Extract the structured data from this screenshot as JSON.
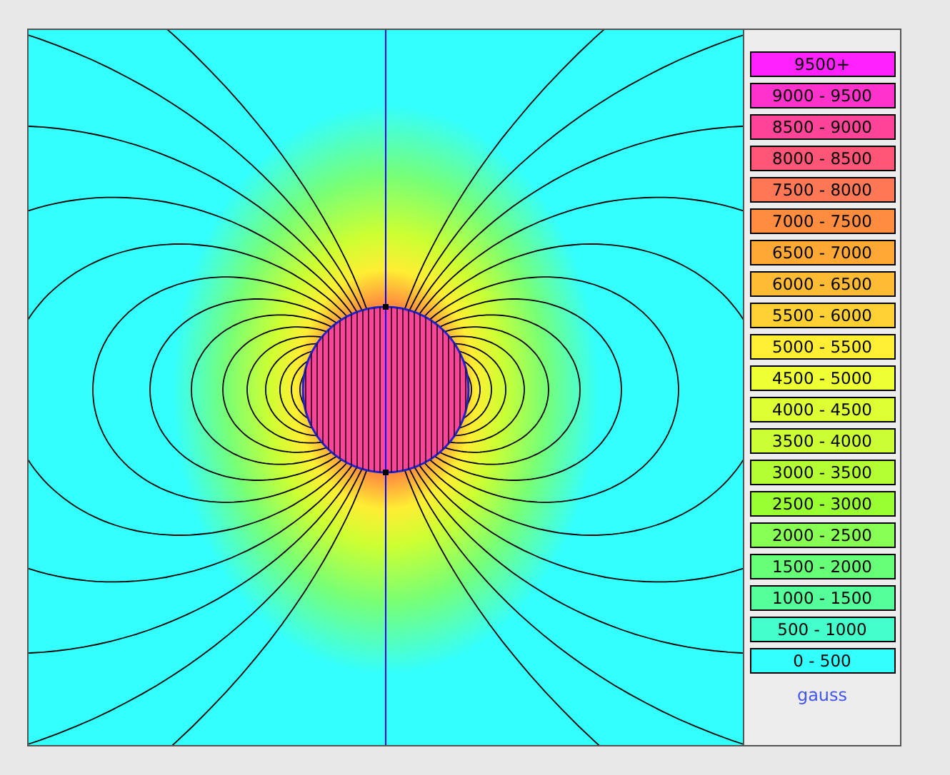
{
  "legend": {
    "items": [
      {
        "label": "9500+",
        "color": "#ff22ff"
      },
      {
        "label": "9000 - 9500",
        "color": "#ff33cc"
      },
      {
        "label": "8500 - 9000",
        "color": "#ff4499"
      },
      {
        "label": "8000 - 8500",
        "color": "#ff5577"
      },
      {
        "label": "7500 - 8000",
        "color": "#ff7755"
      },
      {
        "label": "7000 - 7500",
        "color": "#ff8c3f"
      },
      {
        "label": "6500 - 7000",
        "color": "#ffa833"
      },
      {
        "label": "6000 - 6500",
        "color": "#ffbb33"
      },
      {
        "label": "5500 - 6000",
        "color": "#ffd033"
      },
      {
        "label": "5000 - 5500",
        "color": "#ffee33"
      },
      {
        "label": "4500 - 5000",
        "color": "#eeff33"
      },
      {
        "label": "4000 - 4500",
        "color": "#ddff33"
      },
      {
        "label": "3500 - 4000",
        "color": "#ccff33"
      },
      {
        "label": "3000 - 3500",
        "color": "#b3ff33"
      },
      {
        "label": "2500 - 3000",
        "color": "#99ff33"
      },
      {
        "label": "2000 - 2500",
        "color": "#88ff55"
      },
      {
        "label": "1500 - 2000",
        "color": "#66ff77"
      },
      {
        "label": "1000 - 1500",
        "color": "#55ff99"
      },
      {
        "label": "500 - 1000",
        "color": "#44ffcc"
      },
      {
        "label": "0 - 500",
        "color": "#33ffff"
      }
    ],
    "unit": "gauss"
  }
}
